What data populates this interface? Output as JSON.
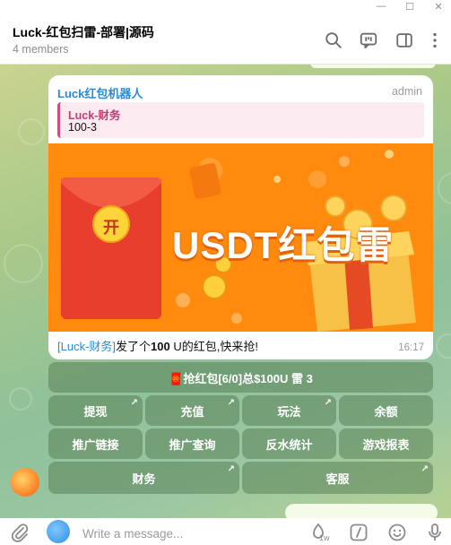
{
  "window": {
    "minimize": "—",
    "maximize": "☐",
    "close": "✕"
  },
  "chat": {
    "title": "Luck-红包扫雷-部署|源码",
    "members": "4 members"
  },
  "message": {
    "sender": "Luck红包机器人",
    "role": "admin",
    "reply": {
      "name": "Luck-财务",
      "text": "100-3"
    },
    "banner": {
      "open_char": "开",
      "headline": "USDT红包雷"
    },
    "caption": {
      "link": "[Luck-财务]",
      "text_before": "发了个",
      "amount": "100",
      "text_after": " U的红包,快来抢!"
    },
    "time": "16:17"
  },
  "keyboard": {
    "grab": "🧧抢红包[6/0]总$100U 雷 3",
    "rows": [
      [
        "提现",
        "充值",
        "玩法",
        "余额"
      ],
      [
        "推广链接",
        "推广查询",
        "反水统计",
        "游戏报表"
      ],
      [
        "财务",
        "客服"
      ]
    ],
    "arrow": "↗"
  },
  "composer": {
    "placeholder": "Write a message...",
    "timer": "1w"
  },
  "colors": {
    "accent": "#2a8bd6",
    "banner": "#ff8a0d",
    "reply_accent": "#d24b7e"
  }
}
